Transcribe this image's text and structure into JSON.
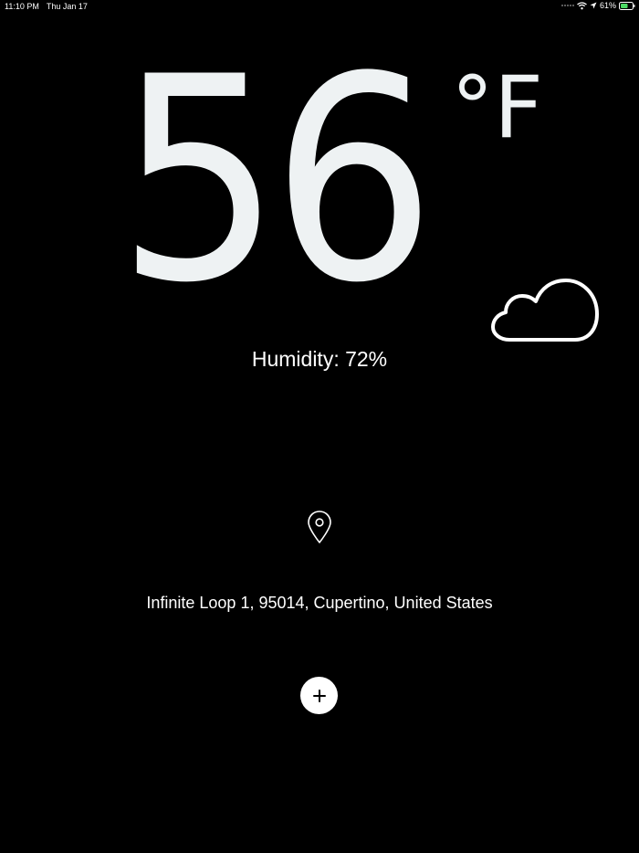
{
  "status_bar": {
    "time": "11:10 PM",
    "date": "Thu Jan 17",
    "battery": "61%",
    "icons": [
      "signal-dots-icon",
      "wifi-icon",
      "location-arrow-icon",
      "battery-icon"
    ]
  },
  "weather": {
    "temperature": "56",
    "unit": "°F",
    "condition_icon": "cloud-icon",
    "humidity": "Humidity: 72%"
  },
  "location": {
    "icon": "map-pin-icon",
    "address": "Infinite Loop 1, 95014, Cupertino, United States"
  },
  "actions": {
    "add_icon": "plus-icon"
  },
  "colors": {
    "background": "#000000",
    "foreground": "#ffffff",
    "temperature": "#eef2f3",
    "battery_fill": "#4cd964"
  }
}
